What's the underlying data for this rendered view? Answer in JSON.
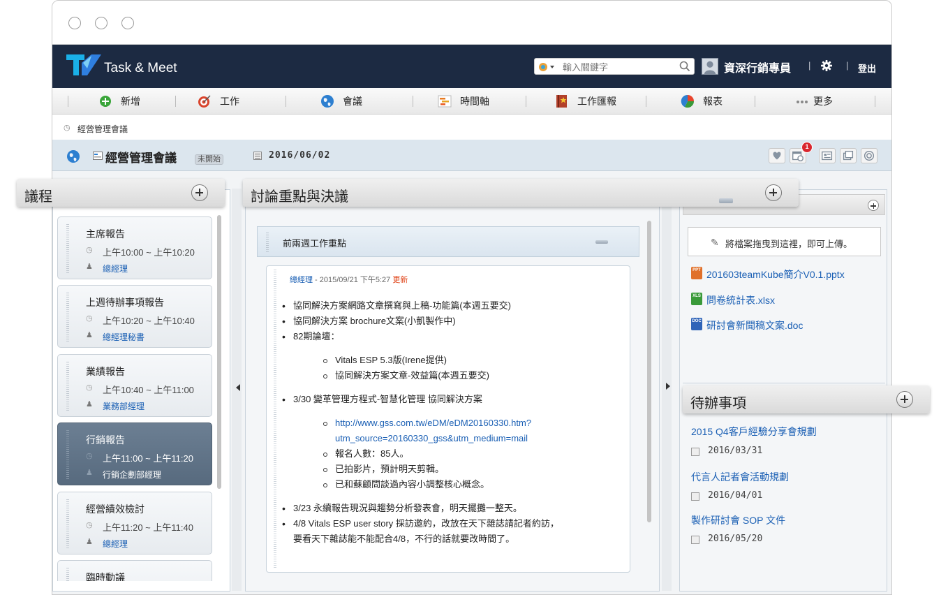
{
  "app": {
    "brand": "Task & Meet",
    "search_placeholder": "輸入關鍵字",
    "username": "資深行銷專員",
    "separator": "|",
    "logout": "登出"
  },
  "menu": {
    "items": [
      {
        "label": "新增",
        "icon": "add-icon"
      },
      {
        "label": "工作",
        "icon": "target-icon"
      },
      {
        "label": "會議",
        "icon": "globe-icon"
      },
      {
        "label": "時間軸",
        "icon": "timeline-icon"
      },
      {
        "label": "工作匯報",
        "icon": "report-book-icon"
      },
      {
        "label": "報表",
        "icon": "pie-chart-icon"
      },
      {
        "label": "更多",
        "icon": "more-dots-icon"
      }
    ]
  },
  "breadcrumb": {
    "text": "經營管理會議"
  },
  "meeting": {
    "title": "經營管理會議",
    "status": "未開始",
    "date": "2016/06/02",
    "notification_count": "1"
  },
  "agenda": {
    "header": "議程",
    "items": [
      {
        "title": "主席報告",
        "time": "上午10:00 ~ 上午10:20",
        "person": "總經理"
      },
      {
        "title": "上週待辦事項報告",
        "time": "上午10:20 ~ 上午10:40",
        "person": "總經理秘書"
      },
      {
        "title": "業績報告",
        "time": "上午10:40 ~ 上午11:00",
        "person": "業務部經理"
      },
      {
        "title": "行銷報告",
        "time": "上午11:00 ~ 上午11:20",
        "person": "行銷企劃部經理",
        "active": true
      },
      {
        "title": "經營績效檢討",
        "time": "上午11:20 ~ 上午11:40",
        "person": "總經理"
      },
      {
        "title": "臨時動議",
        "time": "",
        "person": ""
      }
    ]
  },
  "discussion": {
    "header": "討論重點與決議",
    "section_title": "前兩週工作重點",
    "note": {
      "author": "總經理",
      "meta": " - 2015/09/21 下午5:27 ",
      "update": "更新",
      "lines": [
        {
          "level": 1,
          "text": "協同解決方案網路文章撰寫與上稿-功能篇(本週五要交)"
        },
        {
          "level": 1,
          "text": "協同解決方案 brochure文案(小凱製作中)"
        },
        {
          "level": 1,
          "text": "82期論壇："
        },
        {
          "level": 2,
          "text": "Vitals ESP 5.3版(Irene提供)"
        },
        {
          "level": 2,
          "text": "協同解決方案文章-效益篇(本週五要交)"
        },
        {
          "level": 1,
          "text": "3/30 變革管理方程式-智慧化管理 協同解決方案"
        },
        {
          "level": 2,
          "text": "http://www.gss.com.tw/eDM/eDM20160330.htm?",
          "link": true
        },
        {
          "level": 3,
          "text": "utm_source=20160330_gss&utm_medium=mail",
          "link": true
        },
        {
          "level": 2,
          "text": "報名人數：85人。"
        },
        {
          "level": 2,
          "text": "已拍影片，預計明天剪輯。"
        },
        {
          "level": 2,
          "text": "已和蘇顧問談過內容小調整核心概念。"
        },
        {
          "level": 1,
          "text": "3/23 永續報告現況與趨勢分析發表會，明天擺攤一整天。"
        },
        {
          "level": 1,
          "text": "4/8 Vitals ESP user story 採訪邀約，改放在天下雜誌請記者約訪，"
        },
        {
          "level": 4,
          "text": "要看天下雜誌能不能配合4/8，不行的話就要改時間了。"
        }
      ]
    }
  },
  "files": {
    "drop_text": "將檔案拖曳到這裡，即可上傳。",
    "items": [
      {
        "name": "201603teamKube簡介V0.1.pptx",
        "type": "PPT",
        "color": "#e0702a"
      },
      {
        "name": "問卷統計表.xlsx",
        "type": "XLS",
        "color": "#3a9a3a"
      },
      {
        "name": "研討會新聞稿文案.doc",
        "type": "DOC",
        "color": "#2e63b8"
      }
    ]
  },
  "todo": {
    "header": "待辦事項",
    "items": [
      {
        "title": "2015 Q4客戶經驗分享會規劃",
        "date": "2016/03/31"
      },
      {
        "title": "代言人記者會活動規劃",
        "date": "2016/04/01"
      },
      {
        "title": "製作研討會 SOP 文件",
        "date": "2016/05/20"
      }
    ]
  }
}
